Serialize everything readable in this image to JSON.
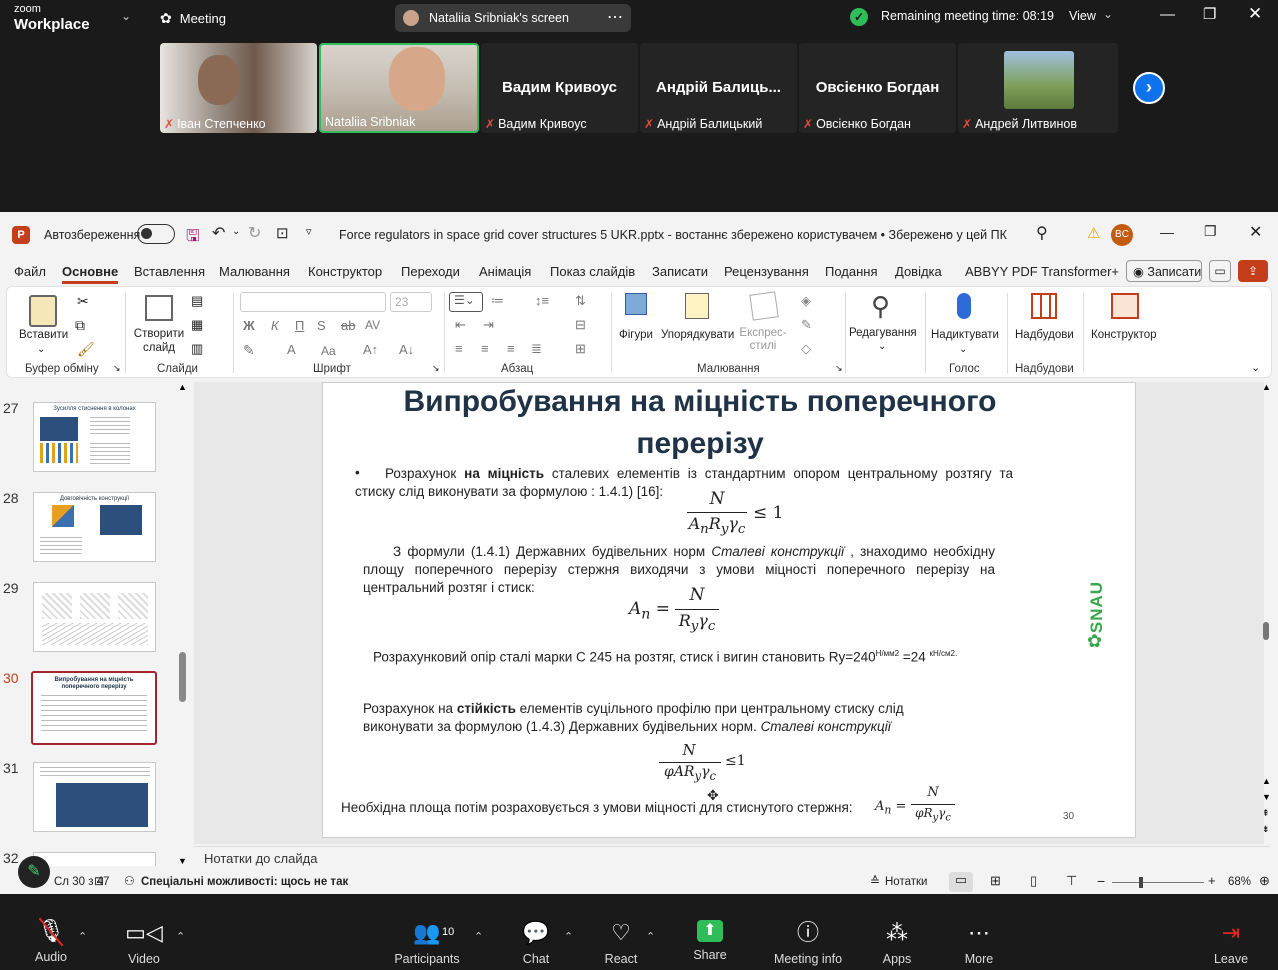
{
  "zoom": {
    "app_name_line1": "zoom",
    "app_name_line2": "Workplace",
    "meeting_label": "Meeting",
    "screen_share_label": "Nataliia Sribniak's screen",
    "remaining_time": "Remaining meeting time: 08:19",
    "view_label": "View",
    "participants": [
      {
        "name": "Іван Степченко",
        "display": "",
        "muted": true,
        "video": true
      },
      {
        "name": "Nataliia Sribniak",
        "display": "",
        "muted": false,
        "video": true,
        "active": true
      },
      {
        "name": "Вадим Кривоус",
        "display": "Вадим Кривоус",
        "muted": true,
        "video": false
      },
      {
        "name": "Андрій Балицький",
        "display": "Андрій Балиць...",
        "muted": true,
        "video": false
      },
      {
        "name": "Овсієнко  Богдан",
        "display": "Овсієнко  Богдан",
        "muted": true,
        "video": false
      },
      {
        "name": "Андрей Литвинов",
        "display": "",
        "muted": true,
        "video": true
      }
    ],
    "toolbar": {
      "audio": "Audio",
      "video": "Video",
      "participants": "Participants",
      "participants_count": "10",
      "chat": "Chat",
      "react": "React",
      "share": "Share",
      "meeting_info": "Meeting info",
      "apps": "Apps",
      "more": "More",
      "leave": "Leave"
    },
    "colors": {
      "share_green": "#2ebd59",
      "active_border": "#2ebd59",
      "leave_red": "#e02828",
      "accent_blue": "#0e72ed"
    }
  },
  "ppt": {
    "autosave_label": "Автозбереження",
    "doc_title": "Force regulators in space grid cover structures 5 UKR.pptx  -  востаннє збережено користувачем  •  Збережено у цей ПК",
    "user_initials": "BC",
    "menu": [
      "Файл",
      "Основне",
      "Вставлення",
      "Малювання",
      "Конструктор",
      "Переходи",
      "Анімація",
      "Показ слайдів",
      "Записати",
      "Рецензування",
      "Подання",
      "Довідка",
      "ABBYY PDF Transformer+"
    ],
    "record_button": "Записати",
    "ribbon": {
      "paste": "Вставити",
      "new_slide": "Створити слайд",
      "font_size": "23",
      "shapes": "Фігури",
      "arrange": "Упорядкувати",
      "quick_styles": "Експрес-стилі",
      "editing": "Редагування",
      "dictate": "Надиктувати",
      "addins": "Надбудови",
      "designer": "Конструктор",
      "groups": [
        "Буфер обміну",
        "Слайди",
        "Шрифт",
        "Абзац",
        "Малювання",
        "Голос",
        "Надбудови"
      ],
      "font_format_glyphs": [
        "Ж",
        "К",
        "П",
        "S",
        "ab",
        "AV"
      ]
    },
    "thumbnails": [
      {
        "num": "27",
        "title": "Зусилля стиснення в колонах"
      },
      {
        "num": "28",
        "title": "Довговічність конструкції"
      },
      {
        "num": "29",
        "title": ""
      },
      {
        "num": "30",
        "title": "Випробування на міцність поперечного перерізу",
        "selected": true
      },
      {
        "num": "31",
        "title": ""
      },
      {
        "num": "32",
        "title": ""
      }
    ],
    "slide": {
      "title_line1": "Випробування на міцність поперечного",
      "title_line2": "перерізу",
      "bullet": "•",
      "p1_a": "Розрахунок ",
      "p1_bold": "на міцність",
      "p1_b": " сталевих елементів із стандартним опором центральному розтягу та стиску слід виконувати за формулою : 1.4.1) [16]:",
      "f1_num": "N",
      "f1_den": "AₙR_yγ_c",
      "f1_rel": "≤ 1",
      "p2_a": "З формули (1.4.1) Державних будівельних норм ",
      "p2_it": "Сталеві конструкції",
      "p2_b": " , знаходимо необхідну площу поперечного перерізу стержня виходячи з умови міцності поперечного перерізу на центральний розтяг і стиск:",
      "f2_lhs": "Aₙ =",
      "f2_num": "N",
      "f2_den": "R_yγ_c",
      "p3": "Розрахунковий опір сталі марки С 245 на розтяг, стиск і вигин становить Ry=240",
      "p3_sup1": "Н/мм2",
      "p3_mid": " =24 ",
      "p3_sup2": "кН/см2.",
      "p4_a": "Розрахунок на ",
      "p4_bold": "стійкість",
      "p4_b": " елементів суцільного профілю при центральному стиску слід виконувати за формулою (1.4.3) Державних будівельних норм. ",
      "p4_it": "Сталеві конструкції",
      "f3_num": "N",
      "f3_den": "φAR_yγ_c",
      "f3_rel": "≤1",
      "p5": "Необхідна площа потім розраховується з умови міцності для стиснутого стержня:",
      "f4_lhs": "Aₙ =",
      "f4_num": "N",
      "f4_den": "φR_yγ_c",
      "page_num": "30",
      "logo": "SNAU"
    },
    "notes_placeholder": "Нотатки до слайда",
    "status": {
      "slide_count": "Сл 30 з 47",
      "accessibility": "Спеціальні можливості: щось не так",
      "notes": "Нотатки",
      "zoom": "68%"
    }
  }
}
